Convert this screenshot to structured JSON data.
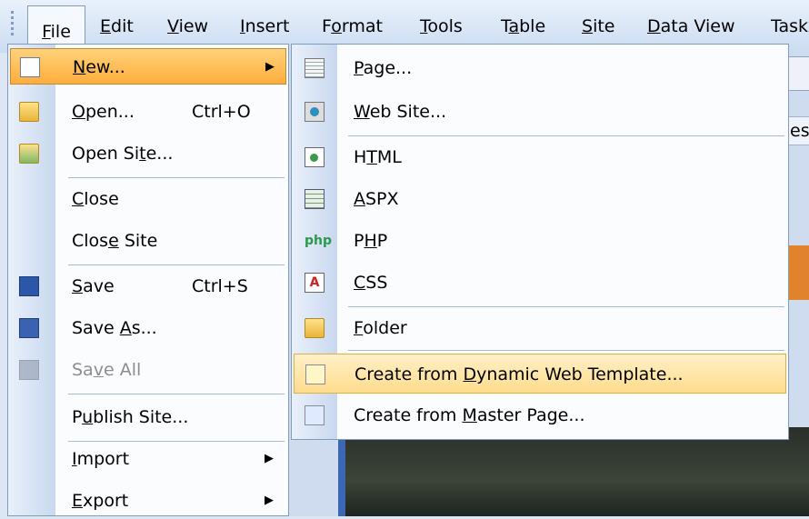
{
  "menubar": {
    "items": [
      {
        "label": "File",
        "underline": "F",
        "rest": "ile"
      },
      {
        "label": "Edit",
        "underline": "E",
        "rest": "dit"
      },
      {
        "label": "View",
        "underline": "V",
        "rest": "iew"
      },
      {
        "label": "Insert",
        "underline": "I",
        "rest": "nsert"
      },
      {
        "label": "Format",
        "pre": "F",
        "underline": "o",
        "rest": "rmat"
      },
      {
        "label": "Tools",
        "underline": "T",
        "rest": "ools"
      },
      {
        "label": "Table",
        "pre": "T",
        "underline": "a",
        "rest": "ble"
      },
      {
        "label": "Site",
        "underline": "S",
        "rest": "ite"
      },
      {
        "label": "Data View",
        "underline": "D",
        "rest": "ata View"
      },
      {
        "label": "Task",
        "underline": "",
        "rest": "Task"
      }
    ]
  },
  "file_menu": {
    "new": {
      "pre": "",
      "u": "N",
      "post": "ew...",
      "icon": "new-document-icon"
    },
    "open": {
      "pre": "",
      "u": "O",
      "post": "pen...",
      "shortcut": "Ctrl+O",
      "icon": "open-folder-icon"
    },
    "open_site": {
      "pre": "Open Si",
      "u": "t",
      "post": "e...",
      "icon": "open-site-icon"
    },
    "close": {
      "pre": "",
      "u": "C",
      "post": "lose"
    },
    "close_site": {
      "pre": "Clos",
      "u": "e",
      "post": " Site"
    },
    "save": {
      "pre": "",
      "u": "S",
      "post": "ave",
      "shortcut": "Ctrl+S",
      "icon": "save-disk-icon"
    },
    "save_as": {
      "pre": "Save ",
      "u": "A",
      "post": "s...",
      "icon": "save-as-icon"
    },
    "save_all": {
      "pre": "Sa",
      "u": "v",
      "post": "e All",
      "icon": "save-all-icon"
    },
    "publish_site": {
      "pre": "P",
      "u": "u",
      "post": "blish Site..."
    },
    "import": {
      "pre": "",
      "u": "I",
      "post": "mport"
    },
    "export": {
      "pre": "",
      "u": "E",
      "post": "xport"
    }
  },
  "new_submenu": {
    "page": {
      "pre": "",
      "u": "P",
      "post": "age..."
    },
    "web_site": {
      "pre": "",
      "u": "W",
      "post": "eb Site..."
    },
    "html": {
      "pre": "H",
      "u": "T",
      "post": "ML"
    },
    "aspx": {
      "pre": "",
      "u": "A",
      "post": "SPX"
    },
    "php": {
      "pre": "P",
      "u": "H",
      "post": "P"
    },
    "css": {
      "pre": "",
      "u": "C",
      "post": "SS"
    },
    "folder": {
      "pre": "",
      "u": "F",
      "post": "older"
    },
    "dwt": {
      "pre": "Create from ",
      "u": "D",
      "post": "ynamic Web Template..."
    },
    "master": {
      "pre": "Create from ",
      "u": "M",
      "post": "aster Page..."
    }
  },
  "background": {
    "edge_text": "es"
  }
}
